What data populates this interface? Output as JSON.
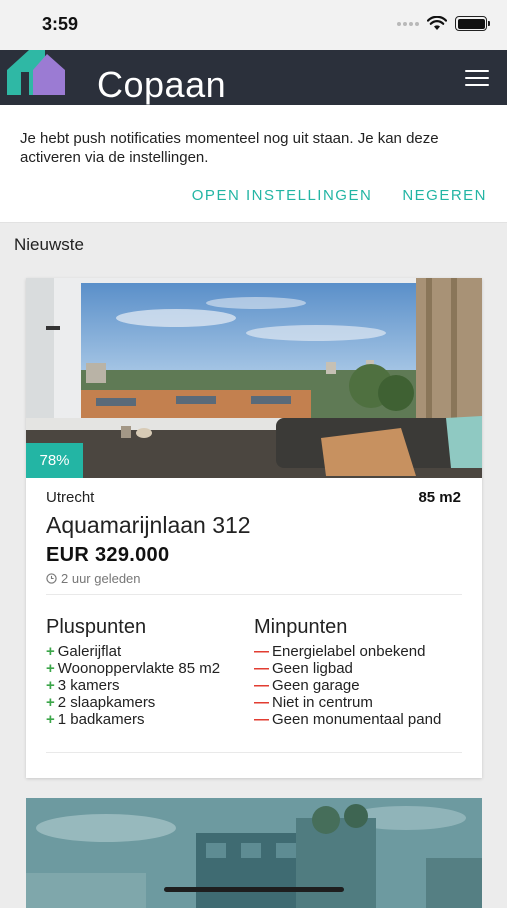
{
  "status_bar": {
    "time": "3:59"
  },
  "app_bar": {
    "title": "Copaan"
  },
  "notice": {
    "text": "Je hebt push notificaties momenteel nog uit staan. Je kan deze activeren via de instellingen.",
    "open_label": "OPEN INSTELLINGEN",
    "ignore_label": "NEGEREN"
  },
  "section_label": "Nieuwste",
  "listing": {
    "match": "78%",
    "city": "Utrecht",
    "size": "85 m2",
    "street": "Aquamarijnlaan 312",
    "price": "EUR 329.000",
    "time": "2 uur geleden",
    "plus_title": "Pluspunten",
    "plus": [
      "Galerijflat",
      "Woonoppervlakte 85 m2",
      "3 kamers",
      "2 slaapkamers",
      "1 badkamers"
    ],
    "minus_title": "Minpunten",
    "minus": [
      "Energielabel onbekend",
      "Geen ligbad",
      "Geen garage",
      "Niet in centrum",
      "Geen monumentaal pand"
    ]
  },
  "colors": {
    "accent": "#23b5a4",
    "app_bar": "#2b303b",
    "plus": "#3ca64a",
    "minus": "#e2392d"
  }
}
